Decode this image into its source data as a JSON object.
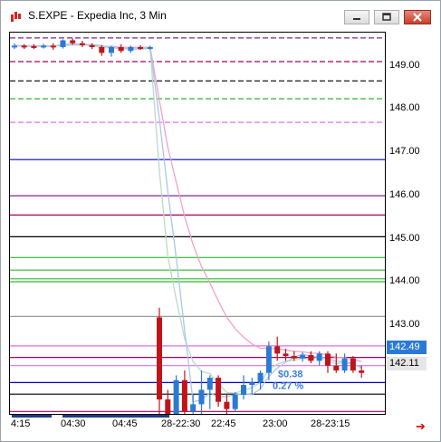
{
  "window": {
    "title": "S.EXPE - Expedia Inc, 3 Min",
    "colors": {
      "up": "#2a7ad5",
      "down": "#c0141b",
      "grid": "#d9d9d9"
    }
  },
  "controls": {
    "minimize": "minimize",
    "maximize": "maximize",
    "close": "close"
  },
  "y_axis": {
    "labels": [
      "149.00",
      "148.00",
      "147.00",
      "146.00",
      "145.00",
      "144.00",
      "143.00"
    ],
    "price_tags": [
      {
        "label": "142.49",
        "bg": "#2a7ad5",
        "color": "#ffffff"
      },
      {
        "label": "142.11",
        "bg": "#e6e6e6",
        "color": "#000000"
      }
    ]
  },
  "x_axis": {
    "labels": [
      "4:15",
      "04:30",
      "04:45",
      "28-22:30",
      "22:45",
      "23:00",
      "28-23:15"
    ]
  },
  "annotation": {
    "amount": "$0.38",
    "percent": "0.27 %"
  },
  "chart_data": {
    "type": "candlestick",
    "ylim": [
      141.7,
      149.6
    ],
    "candles": [
      {
        "o": 149.32,
        "h": 149.38,
        "l": 149.26,
        "c": 149.33
      },
      {
        "o": 149.33,
        "h": 149.36,
        "l": 149.26,
        "c": 149.32
      },
      {
        "o": 149.32,
        "h": 149.36,
        "l": 149.26,
        "c": 149.3
      },
      {
        "o": 149.3,
        "h": 149.37,
        "l": 149.27,
        "c": 149.33
      },
      {
        "o": 149.33,
        "h": 149.38,
        "l": 149.24,
        "c": 149.3
      },
      {
        "o": 149.3,
        "h": 149.46,
        "l": 149.27,
        "c": 149.44
      },
      {
        "o": 149.44,
        "h": 149.48,
        "l": 149.35,
        "c": 149.38
      },
      {
        "o": 149.38,
        "h": 149.43,
        "l": 149.3,
        "c": 149.34
      },
      {
        "o": 149.34,
        "h": 149.38,
        "l": 149.26,
        "c": 149.3
      },
      {
        "o": 149.3,
        "h": 149.34,
        "l": 149.12,
        "c": 149.18
      },
      {
        "o": 149.18,
        "h": 149.33,
        "l": 149.1,
        "c": 149.3
      },
      {
        "o": 149.3,
        "h": 149.36,
        "l": 149.18,
        "c": 149.22
      },
      {
        "o": 149.22,
        "h": 149.33,
        "l": 149.18,
        "c": 149.3
      },
      {
        "o": 149.3,
        "h": 149.34,
        "l": 149.24,
        "c": 149.28
      },
      {
        "o": 149.28,
        "h": 149.33,
        "l": 149.24,
        "c": 149.3
      },
      {
        "o": 143.7,
        "h": 143.9,
        "l": 141.6,
        "c": 142.0
      },
      {
        "o": 142.0,
        "h": 142.2,
        "l": 141.55,
        "c": 141.7
      },
      {
        "o": 141.7,
        "h": 142.5,
        "l": 141.6,
        "c": 142.4
      },
      {
        "o": 142.4,
        "h": 142.6,
        "l": 141.6,
        "c": 141.75
      },
      {
        "o": 141.75,
        "h": 142.1,
        "l": 141.6,
        "c": 141.9
      },
      {
        "o": 141.9,
        "h": 142.6,
        "l": 141.7,
        "c": 142.2
      },
      {
        "o": 142.2,
        "h": 142.5,
        "l": 141.8,
        "c": 142.45
      },
      {
        "o": 142.45,
        "h": 142.5,
        "l": 141.85,
        "c": 141.95
      },
      {
        "o": 141.95,
        "h": 142.1,
        "l": 141.55,
        "c": 141.8
      },
      {
        "o": 141.8,
        "h": 142.15,
        "l": 141.75,
        "c": 142.1
      },
      {
        "o": 142.1,
        "h": 142.5,
        "l": 142.0,
        "c": 142.3
      },
      {
        "o": 142.3,
        "h": 142.45,
        "l": 142.1,
        "c": 142.35
      },
      {
        "o": 142.35,
        "h": 142.6,
        "l": 142.2,
        "c": 142.55
      },
      {
        "o": 142.55,
        "h": 143.2,
        "l": 142.4,
        "c": 143.1
      },
      {
        "o": 143.1,
        "h": 143.3,
        "l": 142.8,
        "c": 142.95
      },
      {
        "o": 142.95,
        "h": 143.05,
        "l": 142.8,
        "c": 142.9
      },
      {
        "o": 142.9,
        "h": 143.0,
        "l": 142.8,
        "c": 142.85
      },
      {
        "o": 142.85,
        "h": 142.98,
        "l": 142.78,
        "c": 142.92
      },
      {
        "o": 142.92,
        "h": 143.0,
        "l": 142.75,
        "c": 142.8
      },
      {
        "o": 142.8,
        "h": 143.0,
        "l": 142.7,
        "c": 142.95
      },
      {
        "o": 142.95,
        "h": 143.0,
        "l": 142.55,
        "c": 142.7
      },
      {
        "o": 142.7,
        "h": 142.95,
        "l": 142.55,
        "c": 142.6
      },
      {
        "o": 142.6,
        "h": 142.95,
        "l": 142.55,
        "c": 142.85
      },
      {
        "o": 142.85,
        "h": 142.9,
        "l": 142.55,
        "c": 142.6
      },
      {
        "o": 142.6,
        "h": 142.7,
        "l": 142.45,
        "c": 142.55
      }
    ],
    "hlines": [
      {
        "y": 149.49,
        "color": "#7b2a8a",
        "dash": true
      },
      {
        "y": 149.0,
        "color": "#a0005a",
        "dash": true
      },
      {
        "y": 148.6,
        "color": "#000000",
        "dash": true
      },
      {
        "y": 148.23,
        "color": "#2db82d",
        "dash": true
      },
      {
        "y": 147.74,
        "color": "#e36ee3",
        "dash": true
      },
      {
        "y": 146.97,
        "color": "#0000c8",
        "dash": false
      },
      {
        "y": 146.22,
        "color": "#7b2a8a",
        "dash": false
      },
      {
        "y": 145.82,
        "color": "#a0005a",
        "dash": false
      },
      {
        "y": 145.37,
        "color": "#000000",
        "dash": false
      },
      {
        "y": 144.94,
        "color": "#2db82d",
        "dash": false
      },
      {
        "y": 144.68,
        "color": "#2db82d",
        "dash": false
      },
      {
        "y": 144.5,
        "color": "#2db82d",
        "dash": false
      },
      {
        "y": 144.44,
        "color": "#2db82d",
        "dash": false
      },
      {
        "y": 143.72,
        "color": "#9a9a9a",
        "dash": false
      },
      {
        "y": 143.11,
        "color": "#e36ee3",
        "dash": false
      },
      {
        "y": 142.87,
        "color": "#a0005a",
        "dash": false
      },
      {
        "y": 142.7,
        "color": "#e36ee3",
        "dash": false
      },
      {
        "y": 142.35,
        "color": "#0000c8",
        "dash": false
      },
      {
        "y": 142.11,
        "color": "#000000",
        "dash": false
      },
      {
        "y": 141.75,
        "color": "#a0005a",
        "dash": false
      },
      {
        "y": 141.3,
        "color": "#7b2a8a",
        "dash": false
      }
    ]
  }
}
